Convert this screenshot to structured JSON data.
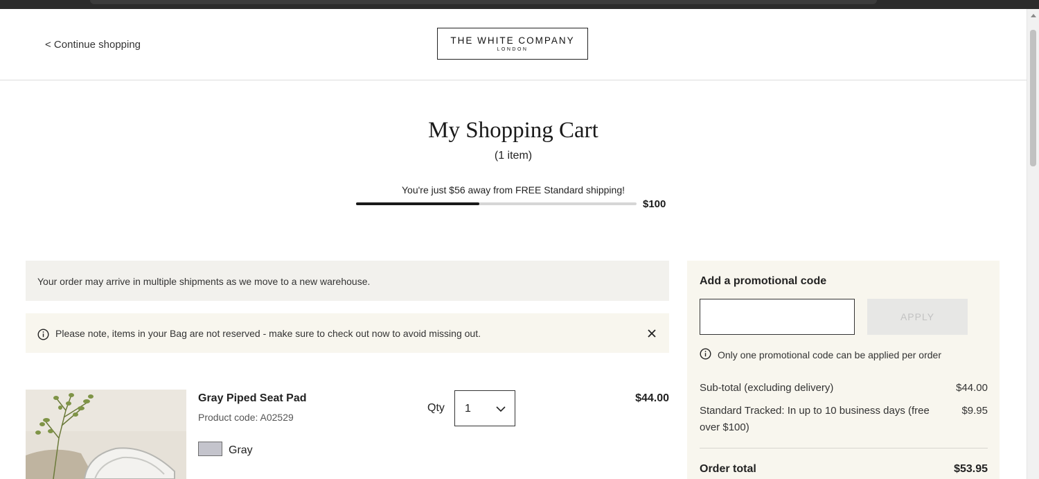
{
  "header": {
    "continue_label": "< Continue shopping",
    "logo_line1": "THE WHITE COMPANY",
    "logo_line2": "LONDON"
  },
  "cart": {
    "title": "My Shopping Cart",
    "item_count": "(1 item)"
  },
  "shipping": {
    "message": "You're just $56 away from FREE Standard shipping!",
    "threshold": "$100",
    "progress_fraction": 0.44
  },
  "notices": {
    "shipments": "Your order may arrive in multiple shipments as we move to a new warehouse.",
    "reserve": "Please note, items in your Bag are not reserved - make sure to check out now to avoid missing out.",
    "close_icon": "close-icon",
    "info_icon": "info-icon"
  },
  "item": {
    "name": "Gray Piped Seat Pad",
    "code": "Product code: A02529",
    "color": "Gray",
    "swatch_color": "#c4c4cc",
    "qty_label": "Qty",
    "qty_value": "1",
    "price": "$44.00"
  },
  "summary": {
    "promo_title": "Add a promotional code",
    "promo_placeholder": "",
    "apply_label": "APPLY",
    "promo_info": "Only one promotional code can be applied per order",
    "subtotal_label": "Sub-total (excluding delivery)",
    "subtotal_value": "$44.00",
    "delivery_label": "Standard Tracked: In up to 10 business days (free over $100)",
    "delivery_value": "$9.95",
    "total_label": "Order total",
    "total_value": "$53.95"
  },
  "colors": {
    "notice_bg": "#f2f1ed",
    "panel_bg": "#f8f6ee",
    "progress_fill": "#1a1a1a"
  }
}
